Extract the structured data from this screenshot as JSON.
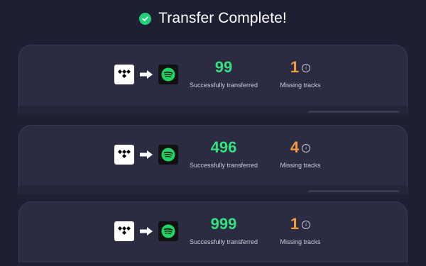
{
  "header": {
    "title": "Transfer Complete!",
    "icon": "check-circle-icon",
    "icon_color": "#22d07a"
  },
  "colors": {
    "background": "#1f1f33",
    "card": "#2b2c42",
    "success": "#35e07f",
    "missing": "#f39a3c"
  },
  "transfers": [
    {
      "source": "tidal-logo",
      "destination": "spotify-logo",
      "transferred_count": "99",
      "transferred_label": "Successfully transferred",
      "missing_count": "1",
      "missing_label": "Missing tracks",
      "info_glyph": "i"
    },
    {
      "source": "tidal-logo",
      "destination": "spotify-logo",
      "transferred_count": "496",
      "transferred_label": "Successfully transferred",
      "missing_count": "4",
      "missing_label": "Missing tracks",
      "info_glyph": "i"
    },
    {
      "source": "tidal-logo",
      "destination": "spotify-logo",
      "transferred_count": "999",
      "transferred_label": "Successfully transferred",
      "missing_count": "1",
      "missing_label": "Missing tracks",
      "info_glyph": "i"
    }
  ]
}
